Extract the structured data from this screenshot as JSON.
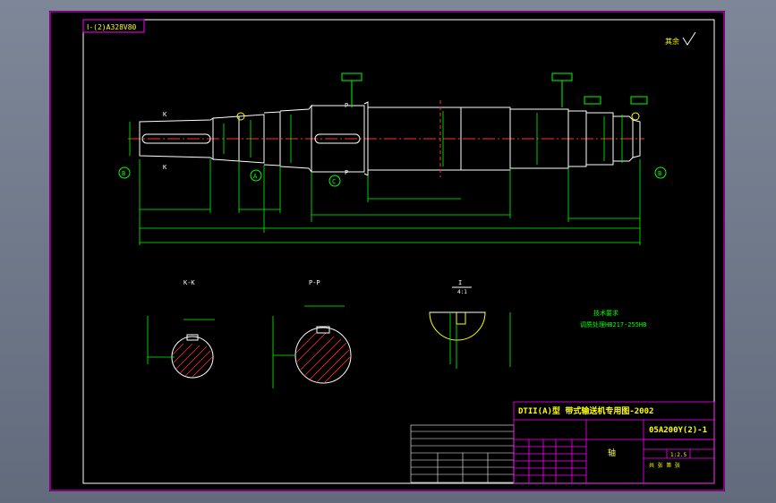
{
  "drawing": {
    "corner_code": "Ⅰ-(2)A328V80",
    "roughness_note": "其余",
    "section_kk_title": "K-K",
    "section_pp_title": "P-P",
    "detail_title": "I",
    "detail_scale": "4:1",
    "datum_a": "A",
    "datum_b": "B",
    "datum_c": "C",
    "mark_k": "K",
    "mark_p": "P",
    "mark_i": "I",
    "tech_req_title": "技术要求",
    "tech_req_line": "调质处理HB217-255HB"
  },
  "title_block": {
    "title": "DTII(A)型  带式输送机专用图-2002",
    "code": "05A200Y(2)-1",
    "part_name": "轴",
    "scale": "1:2.5",
    "sheet": "共  张  第  张"
  },
  "colors": {
    "frame": "#ffffff",
    "outline": "#ffffff",
    "dimension": "#00ff00",
    "centerline": "#ff3030",
    "hatch": "#ff3030",
    "titleblock": "#ff00ff",
    "text_yellow": "#ffff00",
    "text_green": "#00ff00"
  }
}
